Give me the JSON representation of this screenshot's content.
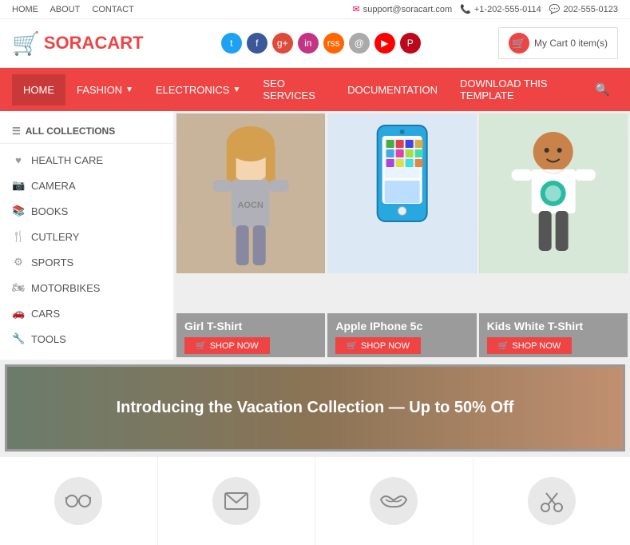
{
  "topbar": {
    "nav_links": [
      "HOME",
      "ABOUT",
      "CONTACT"
    ],
    "email": "support@soracart.com",
    "phone": "+1-202-555-0114",
    "whatsapp": "202-555-0123"
  },
  "header": {
    "logo_text_plain": "SORA",
    "logo_text_accent": "CART",
    "cart_label": "My Cart 0 item(s)",
    "social_icons": [
      "t",
      "f",
      "g+",
      "in",
      "rss",
      "@",
      "yt",
      "p"
    ]
  },
  "nav": {
    "items": [
      {
        "label": "HOME",
        "active": true,
        "has_dropdown": false
      },
      {
        "label": "FASHION",
        "active": false,
        "has_dropdown": true
      },
      {
        "label": "ELECTRONICS",
        "active": false,
        "has_dropdown": true
      },
      {
        "label": "SEO SERVICES",
        "active": false,
        "has_dropdown": false
      },
      {
        "label": "DOCUMENTATION",
        "active": false,
        "has_dropdown": false
      },
      {
        "label": "DOWNLOAD THIS TEMPLATE",
        "active": false,
        "has_dropdown": false
      }
    ]
  },
  "sidebar": {
    "header_label": "ALL COLLECTIONS",
    "items": [
      {
        "icon": "♥",
        "label": "HEALTH CARE"
      },
      {
        "icon": "📷",
        "label": "CAMERA"
      },
      {
        "icon": "📚",
        "label": "BOOKS"
      },
      {
        "icon": "🍴",
        "label": "CUTLERY"
      },
      {
        "icon": "⚙",
        "label": "SPORTS"
      },
      {
        "icon": "🏍",
        "label": "MOTORBIKES"
      },
      {
        "icon": "🚗",
        "label": "CARS"
      },
      {
        "icon": "🔧",
        "label": "TOOLS"
      }
    ]
  },
  "banners": [
    {
      "title": "Girl T-Shirt",
      "shop_label": "SHOP NOW",
      "color1": "#c8b8a2",
      "color2": "#a89880"
    },
    {
      "title": "Apple IPhone 5c",
      "shop_label": "SHOP NOW",
      "color1": "#dde8f5",
      "color2": "#c5d8ee"
    },
    {
      "title": "Kids White T-Shirt",
      "shop_label": "SHOP NOW",
      "color1": "#d5e5d5",
      "color2": "#b8d0b8"
    }
  ],
  "vacation_banner": {
    "text": "Introducing the Vacation Collection — Up to 50% Off"
  },
  "bottom_icons": [
    {
      "icon": "👓",
      "label": "glasses"
    },
    {
      "icon": "✉",
      "label": "envelope"
    },
    {
      "icon": "👄",
      "label": "lips"
    },
    {
      "icon": "✂",
      "label": "scissors"
    }
  ],
  "labels": {
    "shop_now": "SHOP NOW",
    "all_collections": "ALL COLLECTIONS"
  }
}
